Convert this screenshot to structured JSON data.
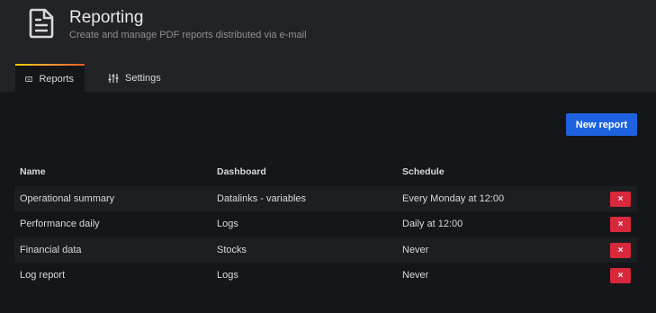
{
  "header": {
    "icon": "document-icon",
    "title": "Reporting",
    "subtitle": "Create and manage PDF reports distributed via e-mail"
  },
  "tabs": [
    {
      "label": "Reports",
      "icon": "keyboard-icon",
      "active": true
    },
    {
      "label": "Settings",
      "icon": "sliders-icon",
      "active": false
    }
  ],
  "actions": {
    "new_report_label": "New report"
  },
  "colors": {
    "primary": "#1f62e0",
    "danger": "#d8283c",
    "accent": "#ff9830"
  },
  "table": {
    "headers": [
      "Name",
      "Dashboard",
      "Schedule"
    ],
    "rows": [
      {
        "name": "Operational summary",
        "dashboard": "Datalinks - variables",
        "schedule": "Every Monday at 12:00",
        "delete": "×"
      },
      {
        "name": "Performance daily",
        "dashboard": "Logs",
        "schedule": "Daily at 12:00",
        "delete": "×"
      },
      {
        "name": "Financial data",
        "dashboard": "Stocks",
        "schedule": "Never",
        "delete": "×"
      },
      {
        "name": "Log report",
        "dashboard": "Logs",
        "schedule": "Never",
        "delete": "×"
      }
    ]
  }
}
